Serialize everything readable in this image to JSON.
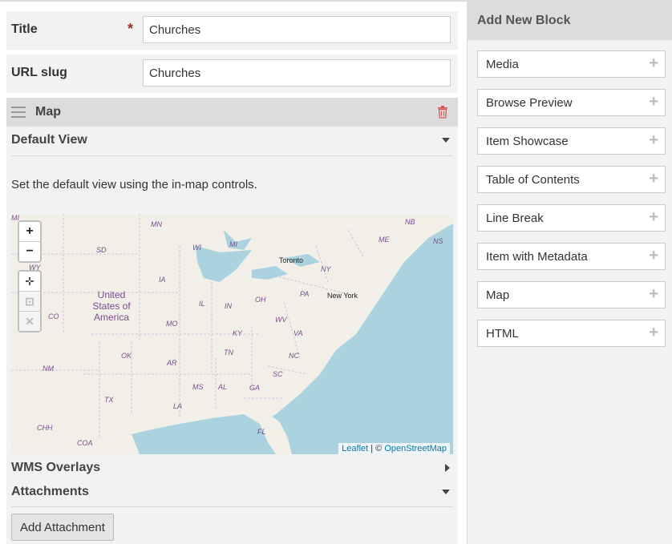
{
  "form": {
    "title": {
      "label": "Title",
      "required_mark": "*",
      "value": "Churches"
    },
    "slug": {
      "label": "URL slug",
      "value": "Churches"
    }
  },
  "block": {
    "title": "Map",
    "default_view": {
      "heading": "Default View",
      "help": "Set the default view using the in-map controls."
    },
    "map": {
      "controls": {
        "zoom_in": "+",
        "zoom_out": "−",
        "locate": "⊹",
        "fit": "⊡",
        "clear": "✕"
      },
      "state_labels": [
        "MI",
        "MN",
        "SD",
        "WI",
        "MI",
        "IA",
        "IL",
        "IN",
        "OH",
        "PA",
        "NY",
        "ME",
        "NB",
        "NS",
        "WY",
        "CO",
        "MO",
        "KY",
        "WV",
        "VA",
        "TN",
        "NC",
        "OK",
        "AR",
        "SC",
        "NM",
        "MS",
        "AL",
        "GA",
        "TX",
        "LA",
        "FL",
        "CHH",
        "COA"
      ],
      "cities": [
        "Toronto",
        "New York"
      ],
      "country": "United States of America",
      "attribution": {
        "leaflet": "Leaflet",
        "sep": " | © ",
        "osm": "OpenStreetMap"
      }
    },
    "wms_overlays": "WMS Overlays",
    "attachments": "Attachments",
    "add_attachment": "Add Attachment"
  },
  "sidebar": {
    "title": "Add New Block",
    "items": [
      {
        "label": "Media"
      },
      {
        "label": "Browse Preview"
      },
      {
        "label": "Item Showcase"
      },
      {
        "label": "Table of Contents"
      },
      {
        "label": "Line Break"
      },
      {
        "label": "Item with Metadata"
      },
      {
        "label": "Map"
      },
      {
        "label": "HTML"
      }
    ],
    "plus": "+"
  },
  "colors": {
    "water": "#aad3df",
    "land": "#f2efe9",
    "required": "#a52a2a",
    "trash": "#d9534f",
    "link": "#0078a8"
  }
}
